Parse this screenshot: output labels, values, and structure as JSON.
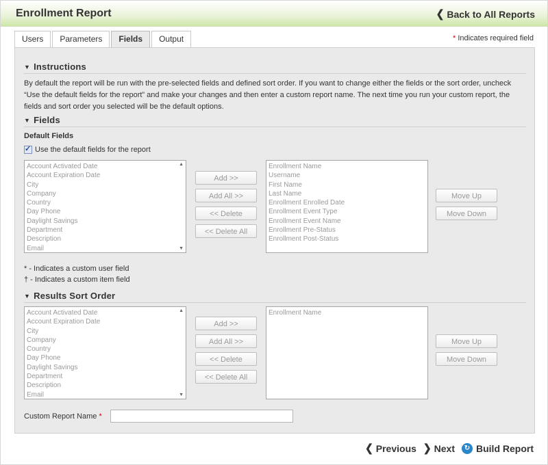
{
  "header": {
    "title": "Enrollment Report",
    "back_label": "Back to All Reports"
  },
  "tabs": [
    {
      "label": "Users"
    },
    {
      "label": "Parameters"
    },
    {
      "label": "Fields"
    },
    {
      "label": "Output"
    }
  ],
  "active_tab": "Fields",
  "required_note": {
    "marker": "*",
    "text": "Indicates required field"
  },
  "instructions": {
    "heading": "Instructions",
    "text": "By default the report will be run with the pre-selected fields and defined sort order. If you want to change either the fields or the sort order, uncheck “Use the default fields for the report” and make your changes and then enter a custom report name. The next time you run your custom report, the fields and sort order you selected will be the default options."
  },
  "fields_section": {
    "heading": "Fields",
    "subheading": "Default Fields",
    "checkbox_label": "Use the default fields for the report",
    "checkbox_checked": true,
    "available": [
      "Account Activated Date",
      "Account Expiration Date",
      "City",
      "Company",
      "Country",
      "Day Phone",
      "Daylight Savings",
      "Department",
      "Description",
      "Email"
    ],
    "selected": [
      "Enrollment Name",
      "Username",
      "First Name",
      "Last Name",
      "Enrollment Enrolled Date",
      "Enrollment Event Type",
      "Enrollment Event Name",
      "Enrollment Pre-Status",
      "Enrollment Post-Status"
    ]
  },
  "buttons": {
    "add": "Add >>",
    "add_all": "Add All >>",
    "delete": "<< Delete",
    "delete_all": "<< Delete All",
    "move_up": "Move Up",
    "move_down": "Move Down"
  },
  "notes": {
    "custom_user": "* - Indicates a custom user field",
    "custom_item": "† - Indicates a custom item field"
  },
  "sort_section": {
    "heading": "Results Sort Order",
    "available": [
      "Account Activated Date",
      "Account Expiration Date",
      "City",
      "Company",
      "Country",
      "Day Phone",
      "Daylight Savings",
      "Department",
      "Description",
      "Email"
    ],
    "selected": [
      "Enrollment Name"
    ]
  },
  "custom_name": {
    "label": "Custom Report Name",
    "marker": "*",
    "value": ""
  },
  "footer": {
    "previous": "Previous",
    "next": "Next",
    "build": "Build Report"
  },
  "colors": {
    "header_gradient_end": "#cfe7a8",
    "panel_bg": "#eaeaea",
    "required": "#cc0000",
    "build_icon": "#2a86c9"
  }
}
